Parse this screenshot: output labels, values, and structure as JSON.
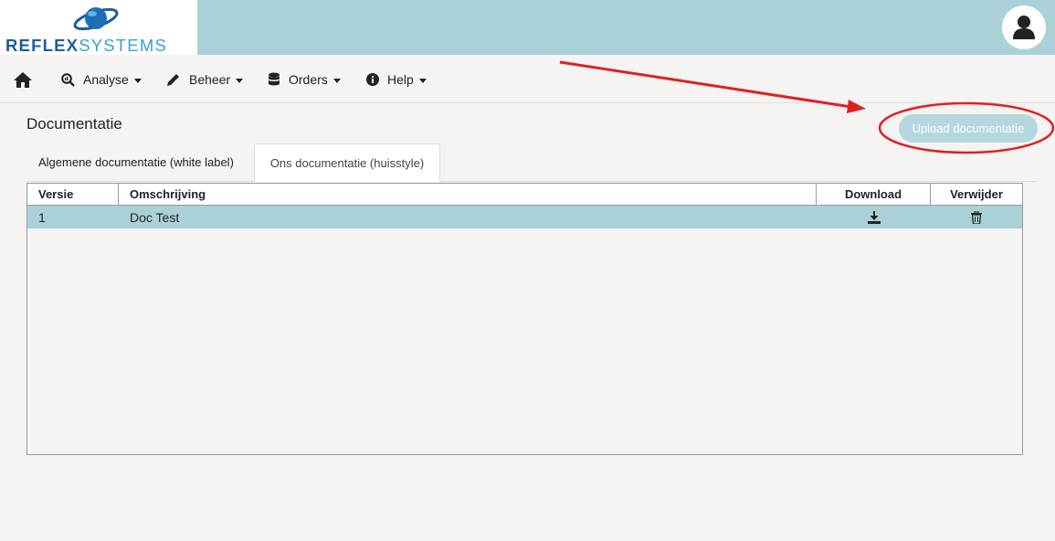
{
  "brand": {
    "logo_part1": "REFLEX",
    "logo_part2": "SYSTEMS"
  },
  "nav": [
    {
      "label": "Analyse",
      "icon": "analytics-icon"
    },
    {
      "label": "Beheer",
      "icon": "pencil-icon"
    },
    {
      "label": "Orders",
      "icon": "database-icon"
    },
    {
      "label": "Help",
      "icon": "info-icon"
    }
  ],
  "page": {
    "title": "Documentatie",
    "upload_label": "Upload documentatie"
  },
  "tabs": [
    {
      "label": "Algemene documentatie (white label)",
      "active": false
    },
    {
      "label": "Ons documentatie (huisstyle)",
      "active": true
    }
  ],
  "table": {
    "columns": [
      "Versie",
      "Omschrijving",
      "Download",
      "Verwijder"
    ],
    "rows": [
      {
        "versie": "1",
        "omschrijving": "Doc Test"
      }
    ]
  },
  "colors": {
    "topbar": "#aad1d8",
    "accent_row": "#aad1d8",
    "button": "#b5d8df",
    "annotation": "#e02020"
  }
}
